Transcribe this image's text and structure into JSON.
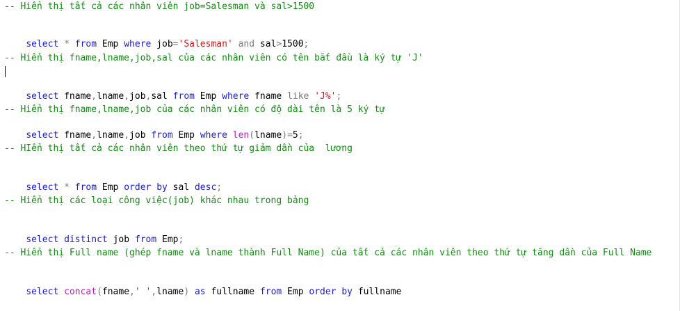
{
  "comments": [
    "-- Hiển thị tất cả các nhân viên job=Salesman và sal>1500",
    "-- Hiển thị fname,lname,job,sal của các nhân viên có tên bắt đầu là ký tự 'J'",
    "-- Hiển thị fname,lname,job của các nhân viên có độ dài tên là 5 ký tự",
    "-- HIển thị tất cả các nhân viên theo thứ tự giảm dần của  lương",
    "-- Hiển thị các loại công việc(job) khác nhau trong bảng",
    "-- Hiển thị Full name (ghép fname và lname thành Full Name) của tất cả các nhân viên theo thứ tự tăng dần của Full Name"
  ],
  "q1": [
    "select",
    " * ",
    "from",
    " Emp ",
    "where",
    " job",
    "=",
    "'Salesman'",
    " and ",
    "sal",
    ">",
    "1500",
    ";"
  ],
  "q2": [
    "select",
    " fname",
    ",",
    "lname",
    ",",
    "job",
    ",",
    "sal ",
    "from",
    " Emp ",
    "where",
    " fname ",
    "like",
    " ",
    "'J%'",
    ";"
  ],
  "q3": [
    "select",
    " fname",
    ",",
    "lname",
    ",",
    "job ",
    "from",
    " Emp ",
    "where",
    " ",
    "len",
    "(",
    "lname",
    ")",
    "=",
    "5",
    ";"
  ],
  "q4": [
    "select",
    " * ",
    "from",
    " Emp ",
    "order",
    " ",
    "by",
    " sal ",
    "desc",
    ";"
  ],
  "q5": [
    "select",
    " ",
    "distinct",
    " job ",
    "from",
    " Emp",
    ";"
  ],
  "q6": [
    "select",
    " ",
    "concat",
    "(",
    "fname",
    ",",
    "' '",
    ",",
    "lname",
    ")",
    " as ",
    "fullname ",
    "from",
    " Emp ",
    "order",
    " ",
    "by",
    " fullname"
  ]
}
